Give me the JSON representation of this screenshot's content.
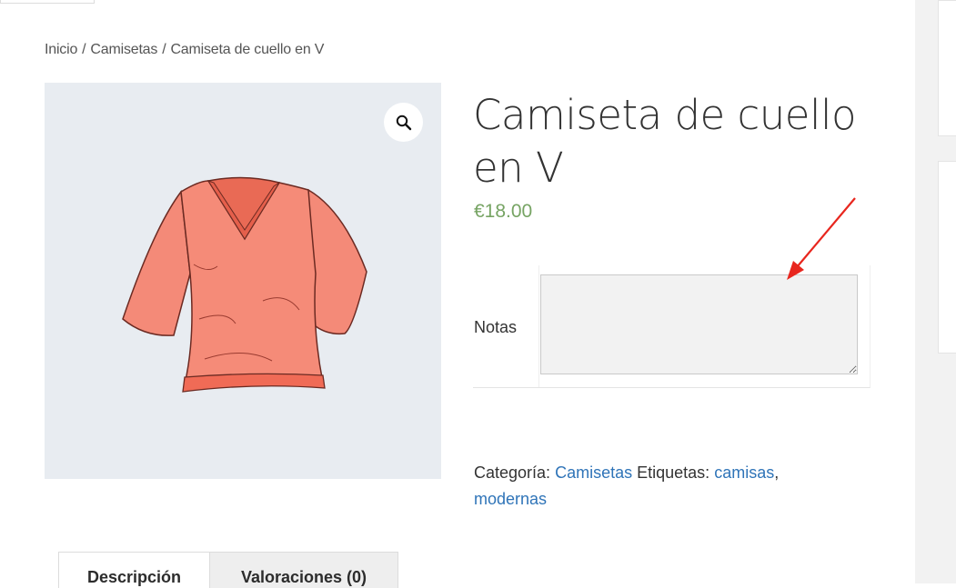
{
  "breadcrumb": {
    "items": [
      "Inicio",
      "Camisetas",
      "Camiseta de cuello en V"
    ],
    "separator": "/"
  },
  "product": {
    "title": "Camiseta de cuello en V",
    "price": "€18.00",
    "image_alt": "t-shirt-illustration",
    "zoom_icon": "magnifier-icon"
  },
  "addon": {
    "label": "Notas",
    "value": "",
    "placeholder": ""
  },
  "meta": {
    "category_label": "Categoría:",
    "category": "Camisetas",
    "tags_label": "Etiquetas:",
    "tags": [
      "camisas",
      "modernas"
    ],
    "tag_separator": ","
  },
  "tabs": [
    {
      "label": "Descripción",
      "active": true
    },
    {
      "label": "Valoraciones (0)",
      "active": false
    }
  ],
  "colors": {
    "price": "#77a464",
    "link": "#2f74b8",
    "annotation_arrow": "#e8261e",
    "gallery_bg": "#e8ecf1",
    "shirt": "#f27866"
  }
}
